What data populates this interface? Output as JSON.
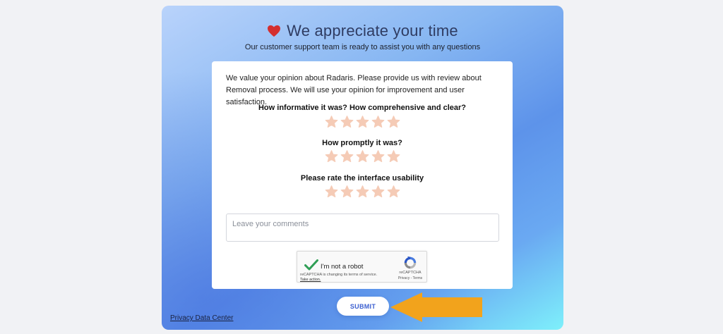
{
  "header": {
    "heart_icon": "heart-icon",
    "heart_color": "#d42f2f",
    "title": "We appreciate your time",
    "subtitle": "Our customer support team is ready to assist you with any questions"
  },
  "form": {
    "intro": "We value your opinion about Radaris. Please provide us with review about Removal process. We will use your opinion for improvement and user satisfaction.",
    "star_color": "#f5cbb6",
    "questions": [
      {
        "label": "How informative it was? How comprehensive and clear?",
        "rating": 0,
        "max": 5
      },
      {
        "label": "How promptly it was?",
        "rating": 0,
        "max": 5
      },
      {
        "label": "Please rate the interface usability",
        "rating": 0,
        "max": 5
      }
    ],
    "comments": {
      "placeholder": "Leave your comments",
      "value": ""
    },
    "recaptcha": {
      "label": "I'm not a robot",
      "note": "reCAPTCHA is changing its terms of service.",
      "action": "Take action.",
      "brand": "reCAPTCHA",
      "links": "Privacy - Terms",
      "checked": true
    }
  },
  "footer": {
    "submit_label": "SUBMIT",
    "privacy_link": "Privacy Data Center",
    "arrow_color": "#f2a31c"
  }
}
